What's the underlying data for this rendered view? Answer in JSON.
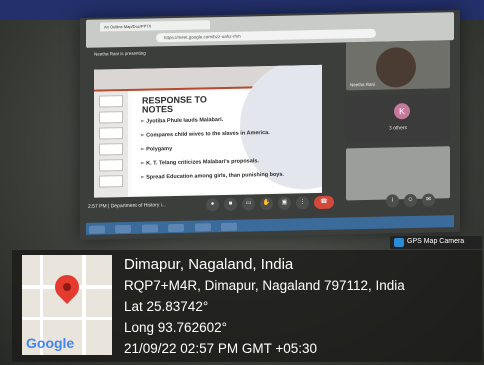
{
  "browser": {
    "tab_title": "An Outline Map/Doc/PPTX",
    "address": "https://meet.google.com/bzz-uahz-rhm"
  },
  "meet": {
    "presenting_text": "Neetha Rani is presenting",
    "slide": {
      "title": "RESPONSE TO NOTES",
      "bullets": [
        "Jyotiba Phule lauds Malabari.",
        "Compares child wives to the slaves in America.",
        "Polygamy",
        "K. T. Telang criticizes Malabari's proposals.",
        "Spread Education among girls, than punishing boys."
      ]
    },
    "tiles": {
      "presenter_name": "Neetha Rani",
      "avatar_letter": "K",
      "others_label": "3 others"
    },
    "meeting_info": "2:57 PM  |  Department of History i...",
    "buttons": [
      "mic-icon",
      "camera-icon",
      "captions-icon",
      "hand-icon",
      "present-icon",
      "more-icon",
      "end-call-icon"
    ]
  },
  "gps": {
    "badge": "GPS Map Camera",
    "map_logo": "Google",
    "city": "Dimapur, Nagaland, India",
    "address": "RQP7+M4R, Dimapur, Nagaland 797112, India",
    "lat": "Lat 25.83742°",
    "long": "Long 93.762602°",
    "datetime": "21/09/22 02:57 PM GMT +05:30"
  }
}
